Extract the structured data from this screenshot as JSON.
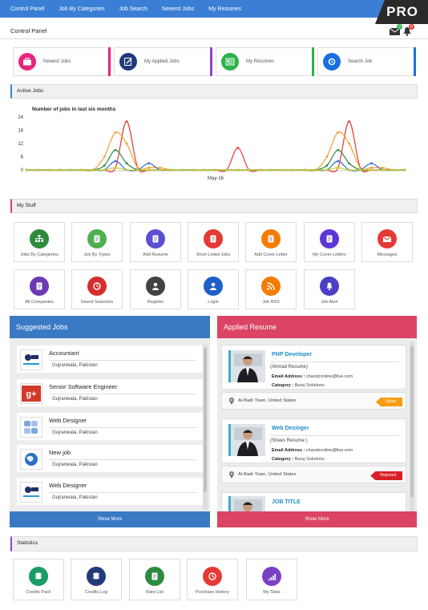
{
  "nav": [
    "Control Panel",
    "Job By Categories",
    "Job Search",
    "Newest Jobs",
    "My Resumes"
  ],
  "pro_label": "PRO",
  "control_panel_title": "Control Panel",
  "notification_badges": [
    "0",
    "0"
  ],
  "quick_links": [
    {
      "label": "Newest Jobs",
      "color": "#e8247c",
      "bar": "#e8247c"
    },
    {
      "label": "My Applied Jobs",
      "color": "#233a7a",
      "bar": "#8e44c8"
    },
    {
      "label": "My Resumes",
      "color": "#2bb34a",
      "bar": "#2bb34a"
    },
    {
      "label": "Search Job",
      "color": "#1a6fe0",
      "bar": "#1a6fe0"
    }
  ],
  "active_jobs": {
    "title": "Active Jobs"
  },
  "chart_data": {
    "type": "line",
    "title": "Number of jobs in last six months",
    "x_tick_label": "May-16",
    "ylim": [
      0,
      24
    ],
    "yticks": [
      0,
      6,
      12,
      18,
      24
    ],
    "x": [
      1,
      2,
      3,
      4,
      5,
      6,
      7,
      8,
      9,
      10,
      11,
      12,
      13,
      14,
      15,
      16,
      17,
      18,
      19,
      20,
      21,
      22,
      23,
      24,
      25,
      26,
      27,
      28,
      29,
      30,
      31,
      32,
      33,
      34,
      35
    ],
    "series": [
      {
        "color": "#e53935",
        "values": [
          0,
          0,
          0,
          0,
          0,
          0,
          0,
          0,
          1,
          22,
          1,
          0,
          0,
          0,
          0,
          0,
          0,
          0,
          0,
          10,
          0,
          0,
          0,
          0,
          0,
          0,
          0,
          0,
          1,
          22,
          1,
          0,
          0,
          0,
          0
        ]
      },
      {
        "color": "#f39c36",
        "values": [
          0,
          0,
          0,
          0,
          0,
          0,
          0,
          6,
          17,
          12,
          1,
          1,
          1,
          0,
          0,
          0,
          0,
          0,
          0,
          0,
          0,
          0,
          0,
          0,
          0,
          0,
          0,
          6,
          17,
          12,
          1,
          1,
          1,
          0,
          0
        ]
      },
      {
        "color": "#2e8b3e",
        "values": [
          0,
          0,
          0,
          0,
          0,
          0,
          0,
          2,
          9,
          3,
          0,
          0,
          0,
          0,
          0,
          0,
          0,
          0,
          0,
          0,
          0,
          0,
          0,
          0,
          0,
          0,
          0,
          2,
          9,
          3,
          0,
          0,
          0,
          0,
          0
        ]
      },
      {
        "color": "#3a6fd0",
        "values": [
          0,
          0,
          0,
          0,
          0,
          0,
          0,
          0,
          4,
          0,
          0,
          3,
          0,
          0,
          0,
          0,
          0,
          0,
          0,
          0,
          0,
          0,
          0,
          0,
          0,
          0,
          0,
          0,
          4,
          0,
          0,
          3,
          0,
          0,
          0
        ]
      },
      {
        "color": "#c8cf2b",
        "values": [
          0,
          0,
          0,
          0,
          0,
          0,
          0,
          0,
          1,
          0,
          0,
          0,
          0,
          0,
          0,
          0,
          0,
          0,
          0,
          0,
          0,
          0,
          0,
          0,
          0,
          0,
          0,
          0,
          1,
          0,
          0,
          0,
          0,
          0,
          0
        ]
      }
    ]
  },
  "my_stuff": {
    "title": "My Stuff",
    "tiles": [
      {
        "label": "Jobs By Categories",
        "color": "#2e8b3e",
        "icon": "org-chart-icon"
      },
      {
        "label": "Job By Types",
        "color": "#4caf50",
        "icon": "type-icon"
      },
      {
        "label": "Add Resume",
        "color": "#5a4fcf",
        "icon": "resume-add-icon"
      },
      {
        "label": "Short Listed Jobs",
        "color": "#e53935",
        "icon": "shortlist-icon"
      },
      {
        "label": "Add Cover Letter",
        "color": "#f57c00",
        "icon": "cover-letter-icon"
      },
      {
        "label": "My Cover Letters",
        "color": "#5e35d6",
        "icon": "letters-icon"
      },
      {
        "label": "Messages",
        "color": "#e53935",
        "icon": "envelope-icon"
      },
      {
        "label": "All Companies",
        "color": "#6a3bb5",
        "icon": "companies-icon"
      },
      {
        "label": "Saved Searches",
        "color": "#d32f2f",
        "icon": "saved-search-icon"
      },
      {
        "label": "Register",
        "color": "#424242",
        "icon": "register-icon"
      },
      {
        "label": "Login",
        "color": "#1e5fc8",
        "icon": "login-icon"
      },
      {
        "label": "Job RSS",
        "color": "#f57c00",
        "icon": "rss-icon"
      },
      {
        "label": "Job Alert",
        "color": "#4a3fc4",
        "icon": "bell-icon"
      }
    ]
  },
  "suggested": {
    "title": "Suggested Jobs",
    "show_more": "Show More",
    "jobs": [
      {
        "title": "Accountant",
        "location": "Gujranwala, Pakistan",
        "logo": "bcm-logo-icon"
      },
      {
        "title": "Senior Software Engineer",
        "location": "Gujranwala, Pakistan",
        "logo": "google-plus-icon"
      },
      {
        "title": "Web Designer",
        "location": "Gujranwala, Pakistan",
        "logo": "puzzle-logo-icon"
      },
      {
        "title": "New job",
        "location": "Gujranwala, Pakistan",
        "logo": "globe-logo-icon"
      },
      {
        "title": "Web Designer",
        "location": "Gujranwala, Pakistan",
        "logo": "bcm-logo-icon"
      }
    ]
  },
  "applied": {
    "title": "Applied Resume",
    "show_more": "Show More",
    "email_label": "Email Address :",
    "category_label": "Category :",
    "resumes": [
      {
        "title": "PHP Developer",
        "name": "(Ahmad Resume)",
        "email": "chandzonline@live.com",
        "category": "Buruj Solutions",
        "location": "Al-Badr Town, United States",
        "status": "Spam",
        "status_color": "#f59d0e"
      },
      {
        "title": "Web Desinger",
        "name": "(Shees Resume )",
        "email": "chandzonline@live.com",
        "category": "Buruj Solutions",
        "location": "Al-Badr Town, United States",
        "status": "Rejected",
        "status_color": "#d91f26"
      },
      {
        "title": "JOB TITLE"
      }
    ]
  },
  "statistics": {
    "title": "Statistics",
    "tiles": [
      {
        "label": "Credits Pack",
        "color": "#1a9c62",
        "icon": "credits-pack-icon"
      },
      {
        "label": "Credits Log",
        "color": "#233a7a",
        "icon": "credits-log-icon"
      },
      {
        "label": "Rate List",
        "color": "#2e8b3e",
        "icon": "rate-list-icon"
      },
      {
        "label": "Purchase History",
        "color": "#e53935",
        "icon": "purchase-history-icon"
      },
      {
        "label": "My Stats",
        "color": "#7b3fc4",
        "icon": "stats-icon"
      }
    ]
  }
}
